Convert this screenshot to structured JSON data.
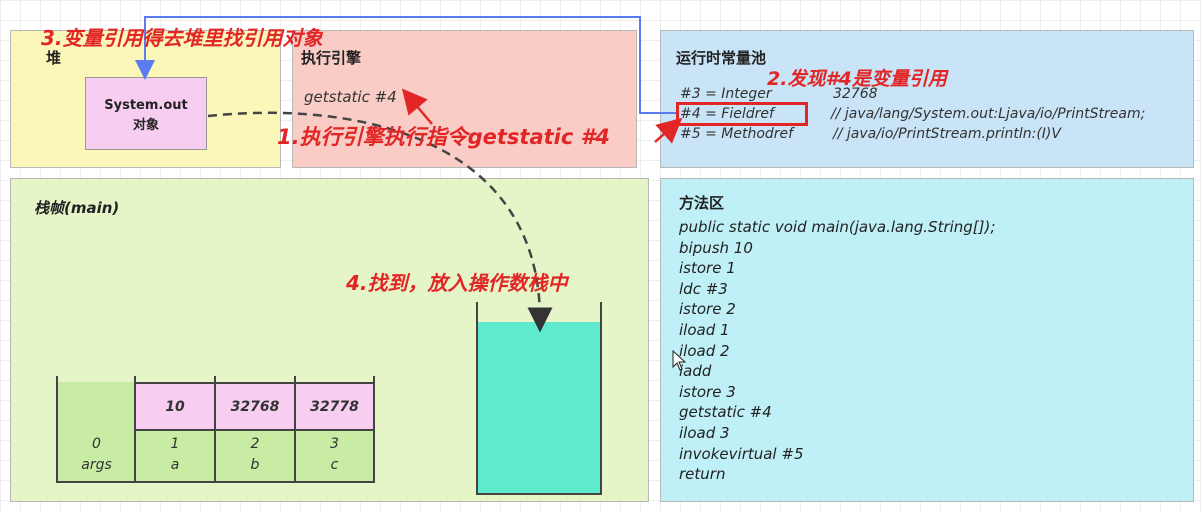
{
  "heap": {
    "title": "堆",
    "object_line1": "System.out",
    "object_line2": "对象"
  },
  "engine": {
    "title": "执行引擎",
    "instruction": "getstatic #4"
  },
  "constant_pool": {
    "title": "运行时常量池",
    "rows": [
      {
        "ref": "#3 = Integer",
        "value": "32768"
      },
      {
        "ref": "#4 = Fieldref",
        "value": "// java/lang/System.out:Ljava/io/PrintStream;"
      },
      {
        "ref": "#5 = Methodref",
        "value": "// java/io/PrintStream.println:(I)V"
      }
    ]
  },
  "stack_frame": {
    "title": "栈帧(main)",
    "local_vars": [
      {
        "value": "",
        "index": "0",
        "name": "args"
      },
      {
        "value": "10",
        "index": "1",
        "name": "a"
      },
      {
        "value": "32768",
        "index": "2",
        "name": "b"
      },
      {
        "value": "32778",
        "index": "3",
        "name": "c"
      }
    ]
  },
  "method_area": {
    "title": "方法区",
    "lines": [
      "public static void main(java.lang.String[]);",
      "bipush 10",
      "istore 1",
      "ldc #3",
      "istore 2",
      "iload 1",
      "iload 2",
      "iadd",
      "istore 3",
      "getstatic #4",
      "iload 3",
      "invokevirtual #5",
      "return"
    ]
  },
  "annotations": {
    "step1": "1.执行引擎执行指令getstatic #4",
    "step2": "2.发现#4是变量引用",
    "step3": "3.变量引用得去堆里找引用对象",
    "step4": "4.找到，放入操作数栈中"
  },
  "colors": {
    "heap_bg": "#fbf7b8",
    "engine_bg": "#f9ccc6",
    "pool_bg": "#c9e3f7",
    "frame_bg": "#e5f5c8",
    "method_bg": "#bfeff7",
    "operand_stack_fill": "#5eebcd",
    "annotation_red": "#e22626",
    "highlight_box": "#e22626",
    "arrow_blue": "#5b7cf0"
  }
}
